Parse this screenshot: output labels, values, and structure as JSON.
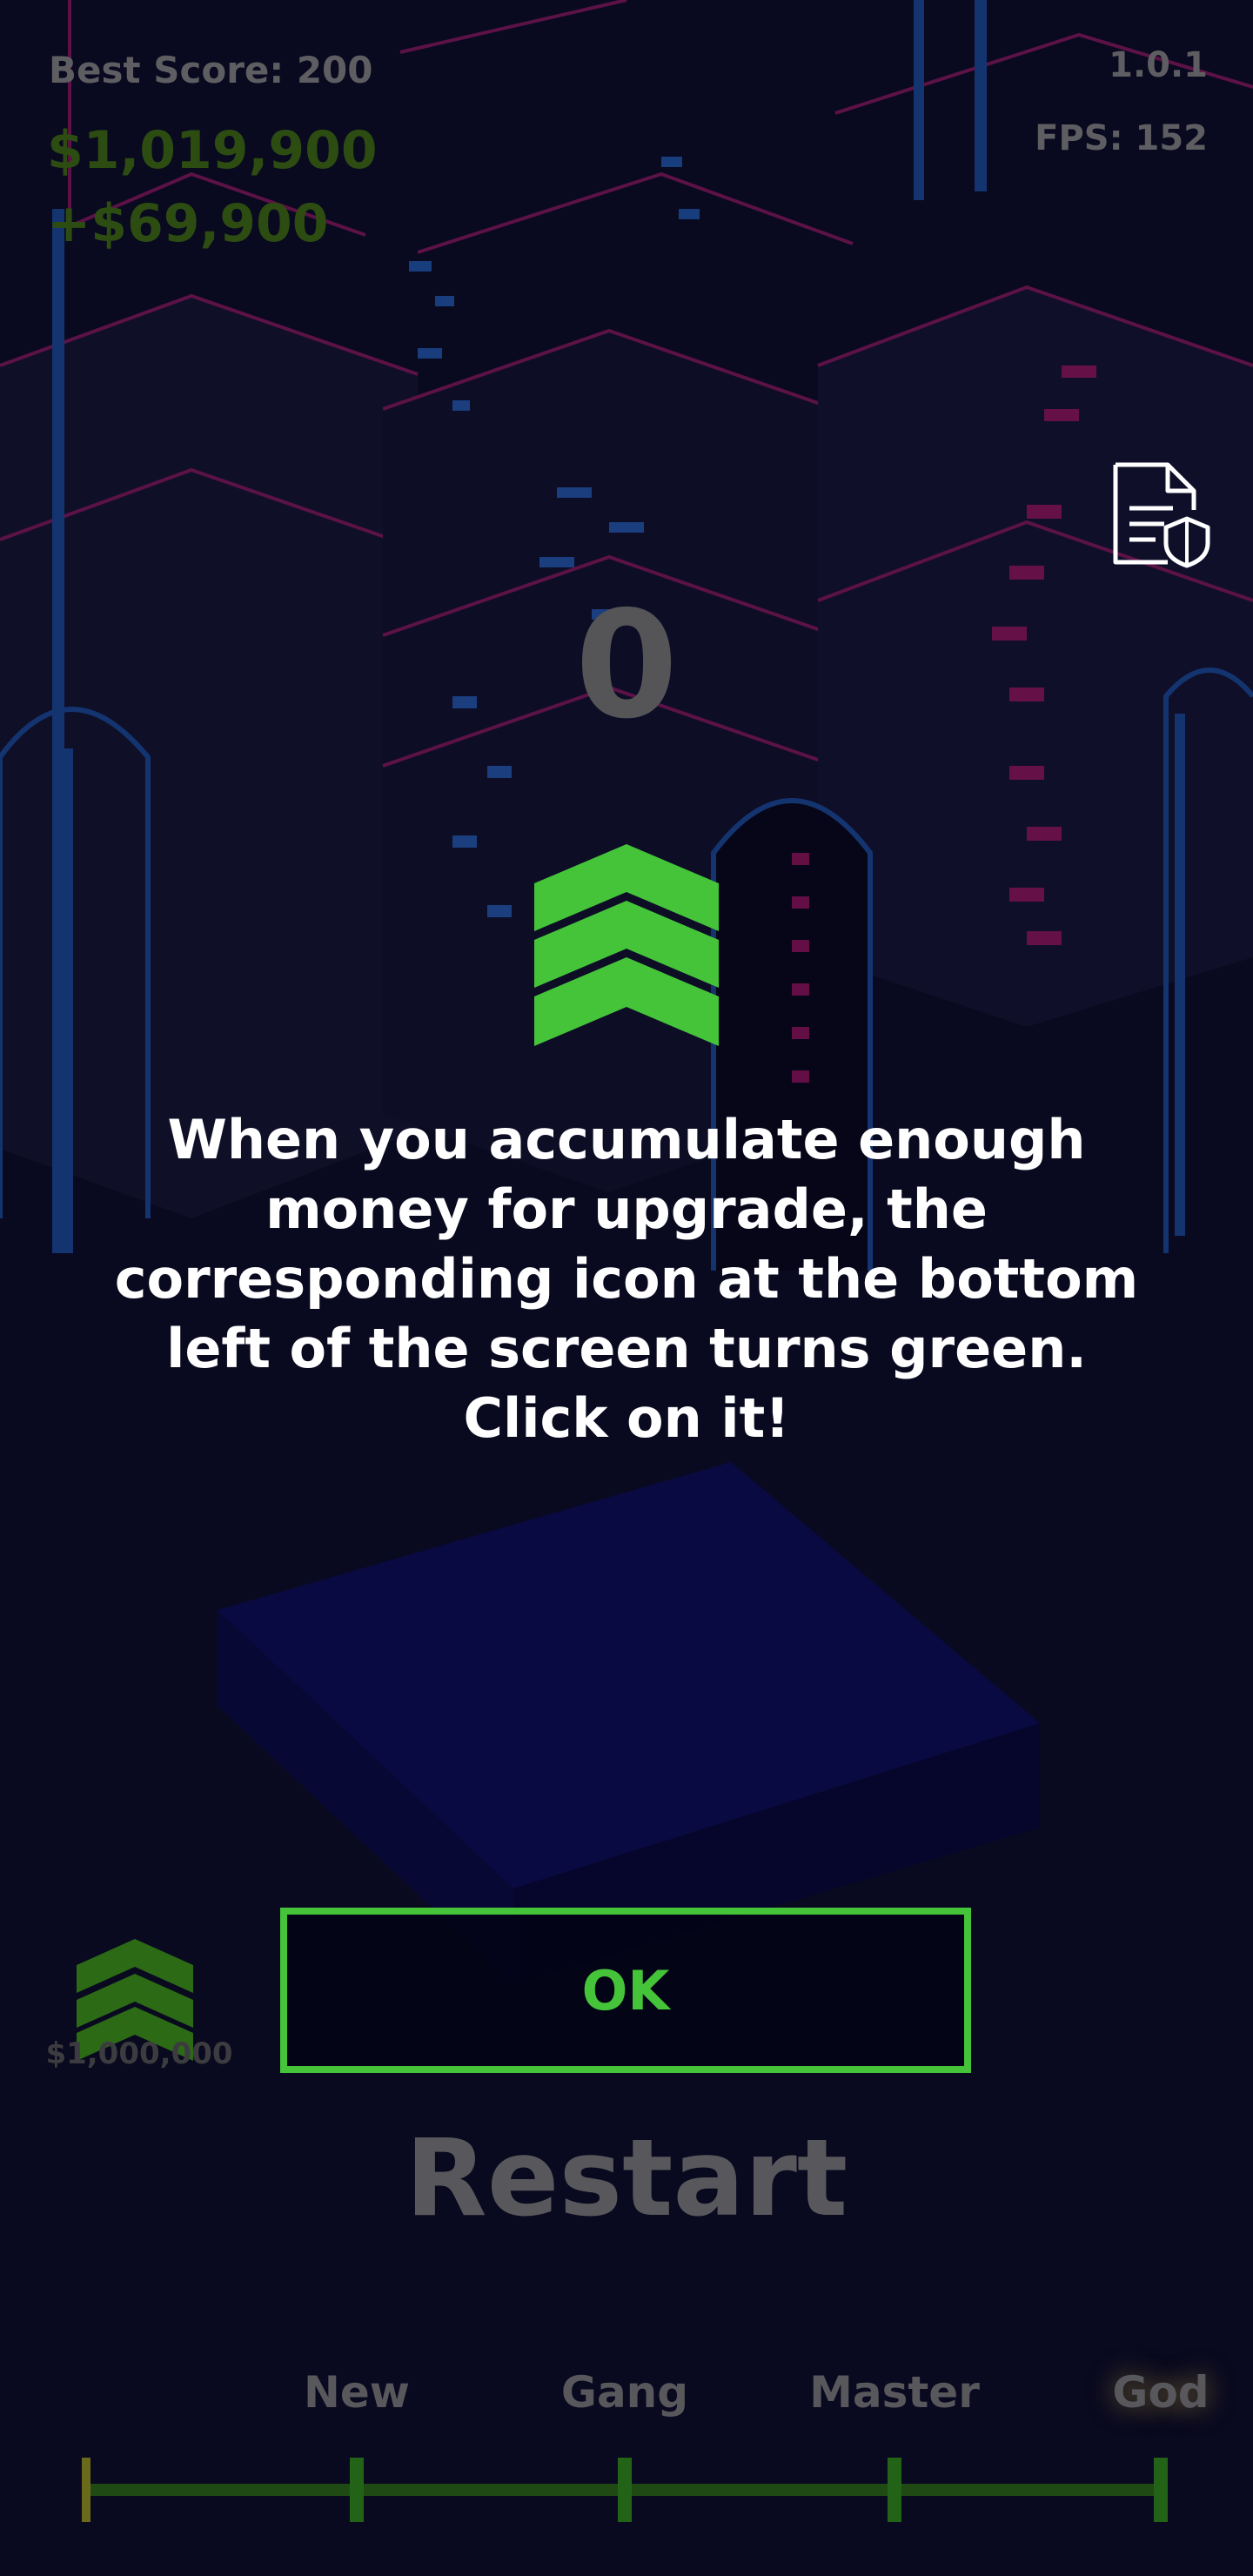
{
  "hud": {
    "best_score": "Best Score: 200",
    "money": "$1,019,900",
    "income": "+$69,900",
    "version": "1.0.1",
    "fps": "FPS: 152"
  },
  "score": "0",
  "tutorial": {
    "message": "When you accumulate enough money for upgrade, the corresponding icon at the bottom left of the screen turns green. Click on it!",
    "ok_label": "OK"
  },
  "upgrade": {
    "cost": "$1,000,000"
  },
  "restart_label": "Restart",
  "progress": {
    "ranks": [
      "New",
      "Gang",
      "Master",
      "God"
    ]
  },
  "icons": {
    "privacy": "document-shield-icon",
    "upgrade": "triple-chevron-up-icon"
  },
  "colors": {
    "accent_green": "#45c43a",
    "background": "#0b0b24",
    "neon_pink": "#b0186a",
    "neon_blue": "#2a6fd8"
  }
}
